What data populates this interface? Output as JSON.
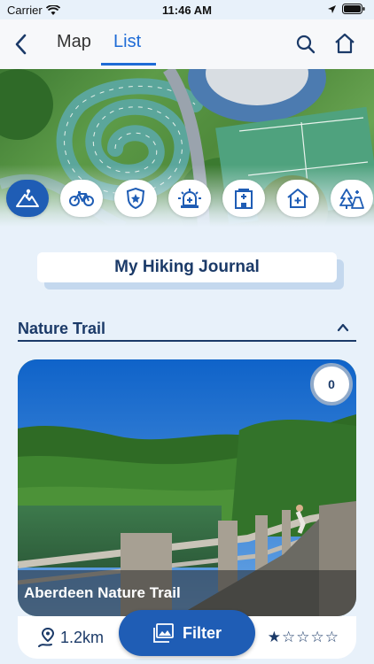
{
  "status_bar": {
    "carrier": "Carrier",
    "time": "11:46 AM"
  },
  "navbar": {
    "tab_map": "Map",
    "tab_list": "List"
  },
  "categories": [
    {
      "icon": "hiking-icon",
      "active": true
    },
    {
      "icon": "bicycle-icon",
      "active": false
    },
    {
      "icon": "police-badge-icon",
      "active": false
    },
    {
      "icon": "siren-icon",
      "active": false
    },
    {
      "icon": "hospital-icon",
      "active": false
    },
    {
      "icon": "shelter-icon",
      "active": false
    },
    {
      "icon": "campsite-icon",
      "active": false
    }
  ],
  "journal": {
    "label": "My Hiking Journal"
  },
  "section": {
    "title": "Nature Trail"
  },
  "trail_card": {
    "name": "Aberdeen Nature Trail",
    "count": "0",
    "distance": "1.2km",
    "rating": 1,
    "rating_max": 5
  },
  "filter": {
    "label": "Filter"
  },
  "colors": {
    "accent": "#1f5db5",
    "text": "#1b3a68",
    "background": "#e8f1fa"
  }
}
